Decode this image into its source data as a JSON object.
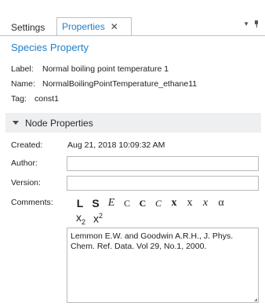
{
  "tabs": [
    {
      "label": "Settings",
      "active": false
    },
    {
      "label": "Properties",
      "active": true,
      "close": "✕"
    }
  ],
  "tab_controls": {
    "dropdown": "▼",
    "pin": "pin-icon"
  },
  "species": {
    "title": "Species Property",
    "fields": [
      {
        "key": "Label:",
        "value": "Normal boiling point temperature 1"
      },
      {
        "key": "Name:",
        "value": "NormalBoilingPointTemperature_ethane11"
      },
      {
        "key": "Tag:",
        "value": "const1"
      }
    ]
  },
  "node_properties": {
    "title": "Node Properties",
    "created_label": "Created:",
    "created_value": "Aug 21, 2018 10:09:32 AM",
    "author_label": "Author:",
    "author_value": "",
    "version_label": "Version:",
    "version_value": "",
    "comments_label": "Comments:",
    "comments_text_line1": "Lemmon E.W. and Goodwin A.R.H., J. Phys.",
    "comments_text_line2": "Chem. Ref. Data. Vol 29, No.1, 2000."
  },
  "format_buttons": [
    {
      "label": "L",
      "name": "bold-large-L-button"
    },
    {
      "label": "S",
      "name": "bold-S-button"
    },
    {
      "label": "E",
      "name": "italic-E-button"
    },
    {
      "label": "C",
      "name": "smallcaps-c-button"
    },
    {
      "label": "C",
      "name": "bold-c-button"
    },
    {
      "label": "C",
      "name": "italic-c-button"
    },
    {
      "label": "x",
      "name": "bold-x-button"
    },
    {
      "label": "x",
      "name": "plain-x-button"
    },
    {
      "label": "x",
      "name": "italic-x-button"
    },
    {
      "label": "α",
      "name": "alpha-button"
    }
  ],
  "script_buttons": {
    "subscript_base": "x",
    "subscript_mark": "2",
    "superscript_base": "x",
    "superscript_mark": "2"
  },
  "colors": {
    "accent": "#1f7fc9",
    "header_bg": "#eeeff1",
    "border": "#b9b9b9"
  }
}
